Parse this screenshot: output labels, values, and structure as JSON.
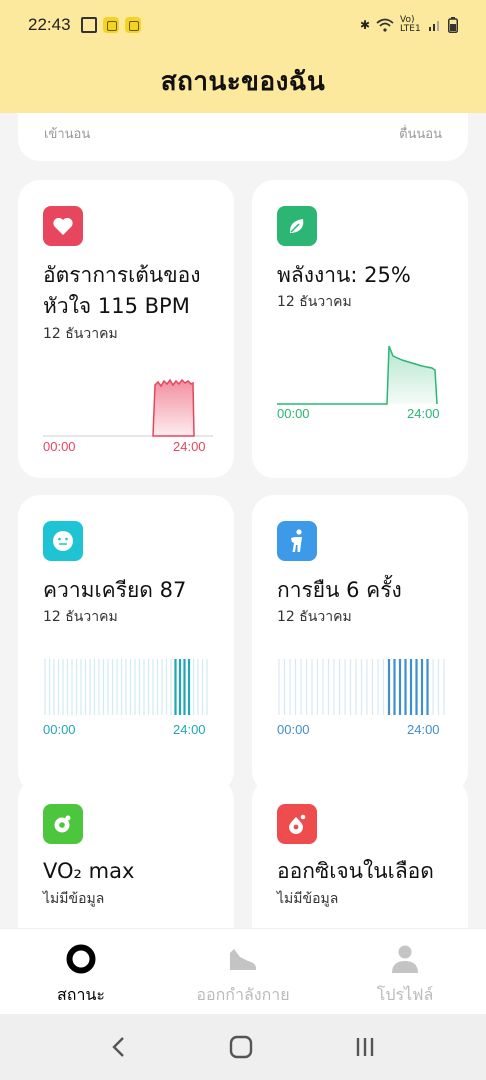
{
  "status_bar": {
    "time": "22:43",
    "network": "Vo) LTE1"
  },
  "header": {
    "title": "สถานะของฉัน"
  },
  "sleep": {
    "bed_label": "เข้านอน",
    "wake_label": "ตื่นนอน"
  },
  "cards": {
    "heart": {
      "title": "อัตราการเต้นของหัวใจ 115 BPM",
      "date": "12 ธันวาคม",
      "x_start": "00:00",
      "x_end": "24:00",
      "color": "#e8455f"
    },
    "energy": {
      "title": "พลังงาน: 25%",
      "date": "12 ธันวาคม",
      "x_start": "00:00",
      "x_end": "24:00",
      "color": "#2bb673"
    },
    "stress": {
      "title": "ความเครียด 87",
      "date": "12 ธันวาคม",
      "x_start": "00:00",
      "x_end": "24:00",
      "color": "#1ea7b4"
    },
    "stand": {
      "title": "การยืน 6 ครั้ง",
      "date": "12 ธันวาคม",
      "x_start": "00:00",
      "x_end": "24:00",
      "color": "#3d8fd0"
    },
    "vo2": {
      "title": "VO₂ max",
      "date": "ไม่มีข้อมูล",
      "color": "#4cc63d"
    },
    "spo2": {
      "title": "ออกซิเจนในเลือด",
      "date": "ไม่มีข้อมูล",
      "color": "#ef4d4d"
    }
  },
  "bottom_nav": {
    "status": "สถานะ",
    "workout": "ออกกำลังกาย",
    "profile": "โปรไฟล์"
  },
  "icons": {
    "heart": "heart-icon",
    "energy": "leaf-icon",
    "stress": "face-icon",
    "stand": "standing-person-icon",
    "vo2": "vo2-icon",
    "spo2": "blood-drop-icon"
  }
}
